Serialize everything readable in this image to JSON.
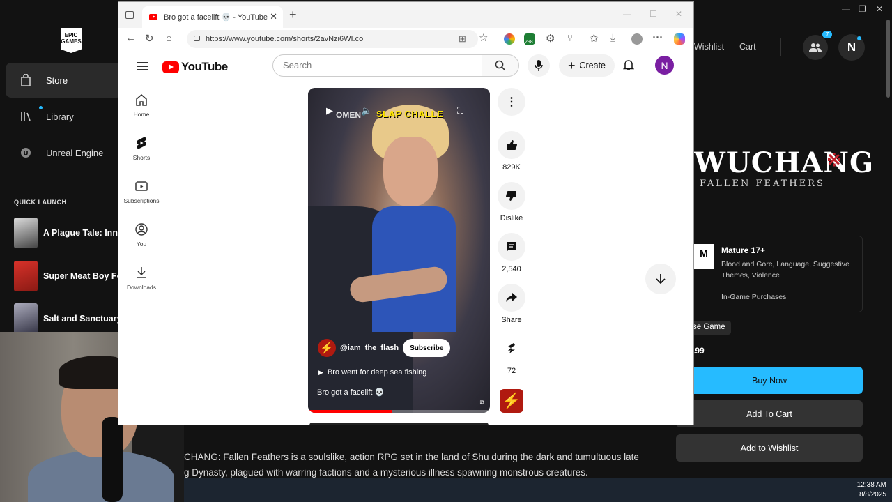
{
  "epic": {
    "logo_text": "EPIC GAMES",
    "nav": [
      {
        "label": "Store",
        "icon": "tag-icon"
      },
      {
        "label": "Library",
        "icon": "library-icon"
      },
      {
        "label": "Unreal Engine",
        "icon": "unreal-icon"
      }
    ],
    "quick_launch_title": "QUICK LAUNCH",
    "quick_launch": [
      {
        "label": "A Plague Tale: Inno"
      },
      {
        "label": "Super Meat Boy Fo"
      },
      {
        "label": "Salt and Sanctuary"
      }
    ],
    "top_links": {
      "wishlist": "Wishlist",
      "cart": "Cart"
    },
    "friends_badge": "7",
    "avatar_letter": "N",
    "game_title_big": "WUCHANG",
    "game_title_small": "FALLEN FEATHERS",
    "rating": {
      "esrb": "M",
      "title": "Mature 17+",
      "desc": "Blood and Gore, Language, Suggestive Themes, Violence",
      "extra": "In-Game Purchases"
    },
    "base_tag": "se Game",
    "price": ".99",
    "buttons": {
      "buy": "Buy Now",
      "cart": "Add To Cart",
      "wishlist": "Add to Wishlist"
    },
    "description_lines": [
      "CHANG: Fallen Feathers is a soulslike, action RPG set in the land of Shu during the dark and tumultuous late",
      "g Dynasty, plagued with warring factions and a mysterious illness spawning monstrous creatures."
    ],
    "colors": {
      "accent": "#26bbff",
      "bg": "#121212"
    }
  },
  "taskbar": {
    "time": "12:38 AM",
    "date": "8/8/2025"
  },
  "browser": {
    "tab_title": "Bro got a facelift 💀 - YouTube",
    "url": "https://www.youtube.com/shorts/2avNzi6WI.co",
    "ext_badge": "298"
  },
  "youtube": {
    "logo_text": "YouTube",
    "search_placeholder": "Search",
    "create_label": "Create",
    "user_initial": "N",
    "guide": [
      {
        "label": "Home",
        "icon": "home-icon"
      },
      {
        "label": "Shorts",
        "icon": "shorts-icon"
      },
      {
        "label": "Subscriptions",
        "icon": "subscriptions-icon"
      },
      {
        "label": "You",
        "icon": "you-icon"
      },
      {
        "label": "Downloads",
        "icon": "downloads-icon"
      }
    ],
    "video": {
      "overlay_title": "SLAP CHALLE",
      "overlay_brand": "OMEN",
      "channel": "@iam_the_flash",
      "subscribe_label": "Subscribe",
      "music": "Bro went for deep sea fishing",
      "caption": "Bro got a facelift 💀",
      "progress": 0.46
    },
    "actions": {
      "likes": "829K",
      "dislike": "Dislike",
      "comments": "2,540",
      "share": "Share",
      "remix": "72"
    },
    "colors": {
      "brand": "#ff0000",
      "avatar": "#7a1fa2"
    }
  }
}
